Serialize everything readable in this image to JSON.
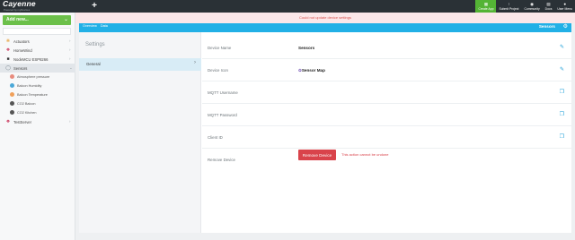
{
  "app": {
    "logo": "Cayenne",
    "logo_subtitle": "Powered by myDevices",
    "new_tab_label": "+"
  },
  "top_actions": [
    {
      "label": "Create App",
      "icon": "mobile-icon",
      "active": true
    },
    {
      "label": "Submit Project",
      "icon": "upload-icon",
      "active": false
    },
    {
      "label": "Community",
      "icon": "chat-icon",
      "active": false
    },
    {
      "label": "Docs",
      "icon": "book-icon",
      "active": false
    },
    {
      "label": "User Menu",
      "icon": "user-icon",
      "active": false
    }
  ],
  "sidebar": {
    "add_new_label": "Add new...",
    "devices": [
      {
        "label": "Actuators",
        "icon": "actuator-icon"
      },
      {
        "label": "HomeWind",
        "icon": "raspberry-icon"
      },
      {
        "label": "NodeMCU ESP8266",
        "icon": "board-icon"
      },
      {
        "label": "Sensors",
        "icon": "sensor-icon",
        "selected": true
      }
    ],
    "sensors": [
      {
        "label": "Atmosphere pressure",
        "color": "#e88b7d"
      },
      {
        "label": "Balcon Humidity",
        "color": "#4aa8d8"
      },
      {
        "label": "Balcon Temperature",
        "color": "#f0a05a"
      },
      {
        "label": "CO2 Balcon",
        "color": "#555555"
      },
      {
        "label": "CO2 Kitchen",
        "color": "#555555"
      }
    ],
    "extra_devices": [
      {
        "label": "TestServer",
        "icon": "raspberry-icon"
      }
    ]
  },
  "error_message": "Could not update device settings",
  "device_bar": {
    "tabs": [
      "Overview",
      "Data"
    ],
    "device_name": "Sensors"
  },
  "settings": {
    "title": "Settings",
    "nav": [
      {
        "label": "General"
      }
    ],
    "rows": [
      {
        "key": "Device Name",
        "value": "Sensors",
        "action": "edit-icon"
      },
      {
        "key": "Device Icon",
        "value": "Sensor Map",
        "action": "edit-icon"
      },
      {
        "key": "MQTT Username",
        "value": "",
        "action": "copy-icon"
      },
      {
        "key": "MQTT Password",
        "value": "",
        "action": "copy-icon"
      },
      {
        "key": "Client ID",
        "value": "",
        "action": "copy-icon"
      },
      {
        "key": "Remove Device",
        "value": "",
        "action": ""
      }
    ],
    "remove_button_label": "Remove Device",
    "remove_warning": "This action cannot be undone"
  },
  "colors": {
    "accent_green": "#6cc04a",
    "accent_blue": "#22b0e6",
    "danger": "#d9434b"
  }
}
